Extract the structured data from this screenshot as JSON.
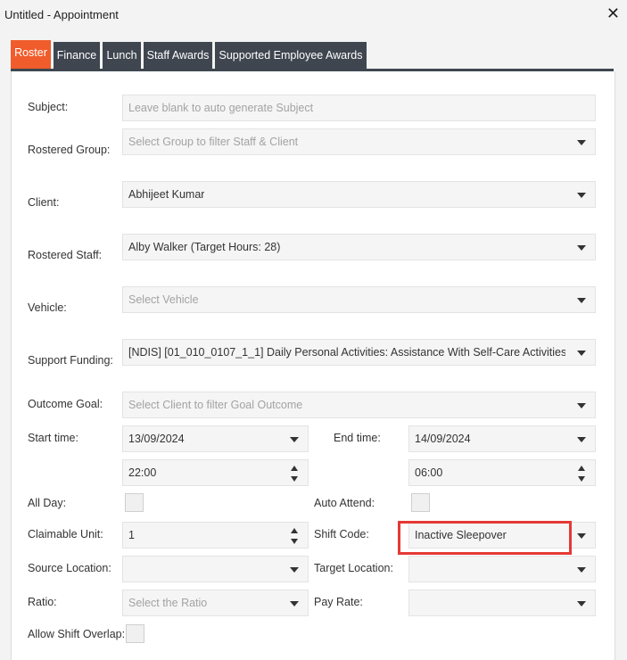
{
  "window": {
    "title": "Untitled - Appointment",
    "close_glyph": "✕"
  },
  "tabs": [
    {
      "label": "Roster",
      "active": true
    },
    {
      "label": "Finance"
    },
    {
      "label": "Lunch"
    },
    {
      "label": "Staff Awards"
    },
    {
      "label": "Supported Employee Awards"
    }
  ],
  "form": {
    "subject": {
      "label": "Subject:",
      "placeholder": "Leave blank to auto generate Subject"
    },
    "rostered_group": {
      "label": "Rostered Group:",
      "placeholder": "Select Group to filter Staff & Client"
    },
    "client": {
      "label": "Client:",
      "value": "Abhijeet Kumar"
    },
    "rostered_staff": {
      "label": "Rostered Staff:",
      "value": "Alby Walker (Target Hours: 28)"
    },
    "vehicle": {
      "label": "Vehicle:",
      "placeholder": "Select Vehicle"
    },
    "support_funding": {
      "label": "Support Funding:",
      "value": "[NDIS] [01_010_0107_1_1] Daily Personal Activities: Assistance With Self-Care Activities -"
    },
    "outcome_goal": {
      "label": "Outcome Goal:",
      "placeholder": "Select Client to filter Goal Outcome"
    },
    "start_time": {
      "label": "Start time:",
      "date": "13/09/2024",
      "time": "22:00"
    },
    "end_time": {
      "label": "End time:",
      "date": "14/09/2024",
      "time": "06:00"
    },
    "all_day": {
      "label": "All Day:"
    },
    "auto_attend": {
      "label": "Auto Attend:"
    },
    "claimable_unit": {
      "label": "Claimable Unit:",
      "value": "1"
    },
    "shift_code": {
      "label": "Shift Code:",
      "value": "Inactive Sleepover"
    },
    "source_location": {
      "label": "Source Location:",
      "value": ""
    },
    "target_location": {
      "label": "Target Location:",
      "value": ""
    },
    "ratio": {
      "label": "Ratio:",
      "placeholder": "Select the Ratio"
    },
    "pay_rate": {
      "label": "Pay Rate:",
      "value": ""
    },
    "allow_shift_overlap": {
      "label": "Allow Shift Overlap:"
    }
  },
  "colors": {
    "active_tab": "#f05c2b",
    "tab": "#3f4650",
    "highlight": "#e53935"
  }
}
